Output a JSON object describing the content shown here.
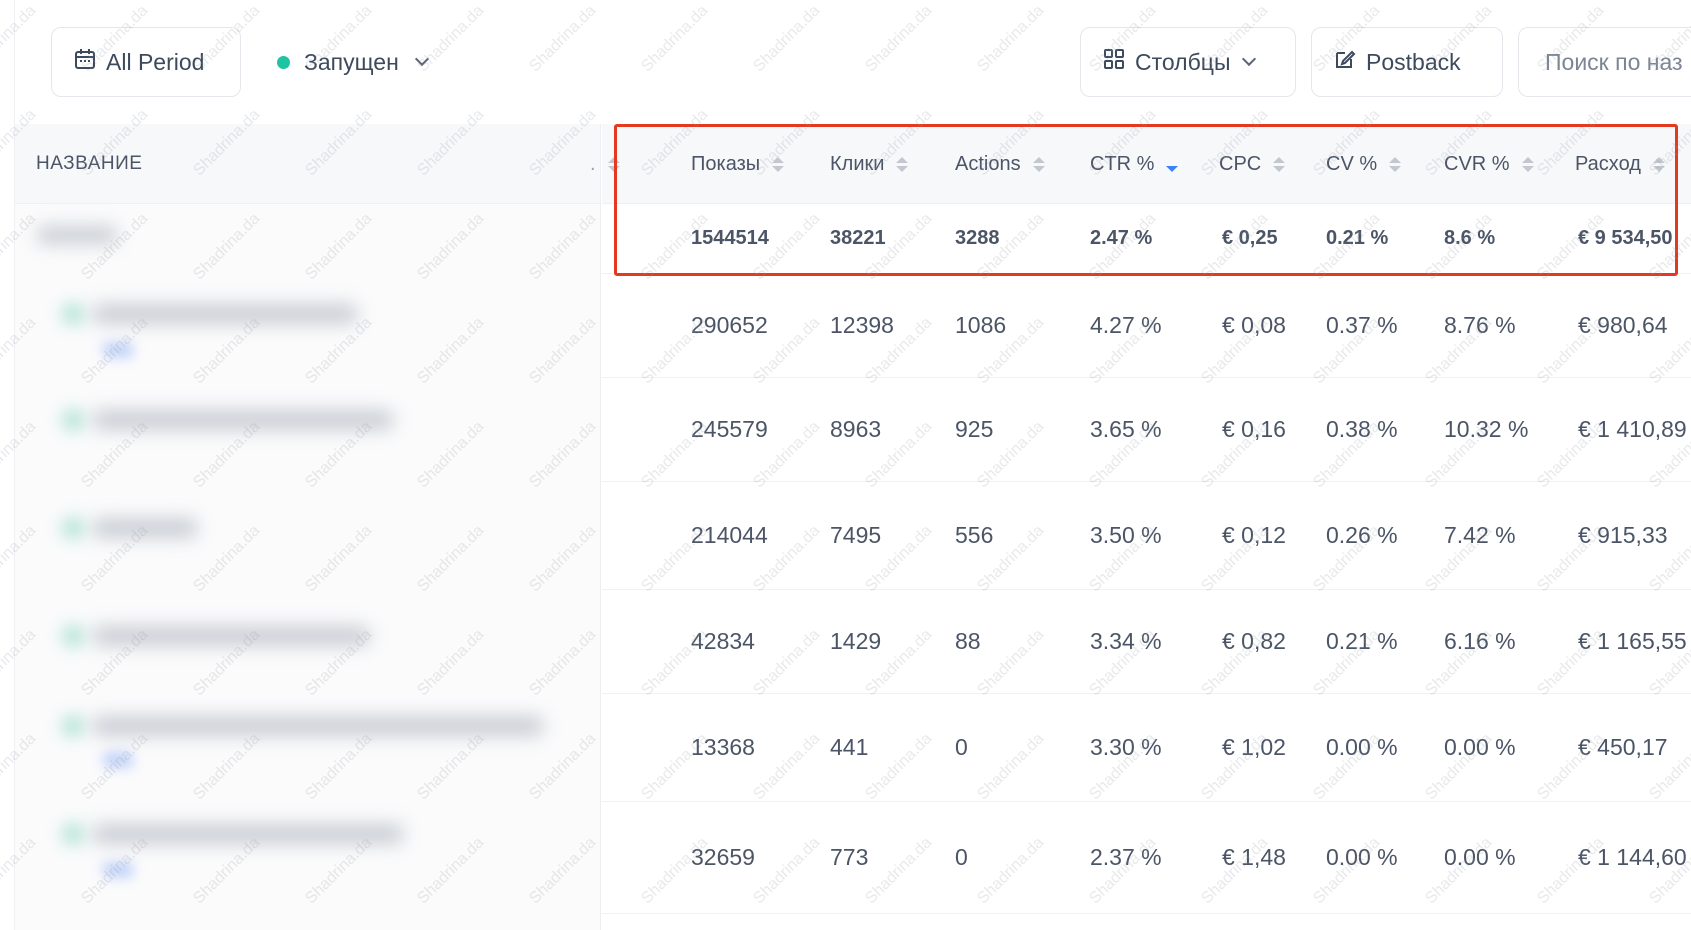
{
  "toolbar": {
    "period_label": "All Period",
    "status_label": "Запущен",
    "status_color": "#1cc4a1",
    "columns_label": "Столбцы",
    "postback_label": "Postback",
    "search_placeholder": "Поиск по наз"
  },
  "table": {
    "name_header": "НАЗВАНИЕ",
    "hidden_col_header": ".",
    "columns": [
      "Показы",
      "Клики",
      "Actions",
      "CTR %",
      "CPC",
      "CV %",
      "CVR %",
      "Расход"
    ],
    "sorted_column": "CTR %",
    "sort_direction": "desc",
    "total": [
      "1544514",
      "38221",
      "3288",
      "2.47 %",
      "€ 0,25",
      "0.21 %",
      "8.6 %",
      "€ 9 534,50"
    ],
    "rows": [
      [
        "290652",
        "12398",
        "1086",
        "4.27 %",
        "€ 0,08",
        "0.37 %",
        "8.76 %",
        "€ 980,64"
      ],
      [
        "245579",
        "8963",
        "925",
        "3.65 %",
        "€ 0,16",
        "0.38 %",
        "10.32 %",
        "€ 1 410,89"
      ],
      [
        "214044",
        "7495",
        "556",
        "3.50 %",
        "€ 0,12",
        "0.26 %",
        "7.42 %",
        "€ 915,33"
      ],
      [
        "42834",
        "1429",
        "88",
        "3.34 %",
        "€ 0,82",
        "0.21 %",
        "6.16 %",
        "€ 1 165,55"
      ],
      [
        "13368",
        "441",
        "0",
        "3.30 %",
        "€ 1,02",
        "0.00 %",
        "0.00 %",
        "€ 450,17"
      ],
      [
        "32659",
        "773",
        "0",
        "2.37 %",
        "€ 1,48",
        "0.00 %",
        "0.00 %",
        "€ 1 144,60"
      ]
    ]
  },
  "highlight_color": "#e5391f",
  "watermark": "Shadrina.da"
}
